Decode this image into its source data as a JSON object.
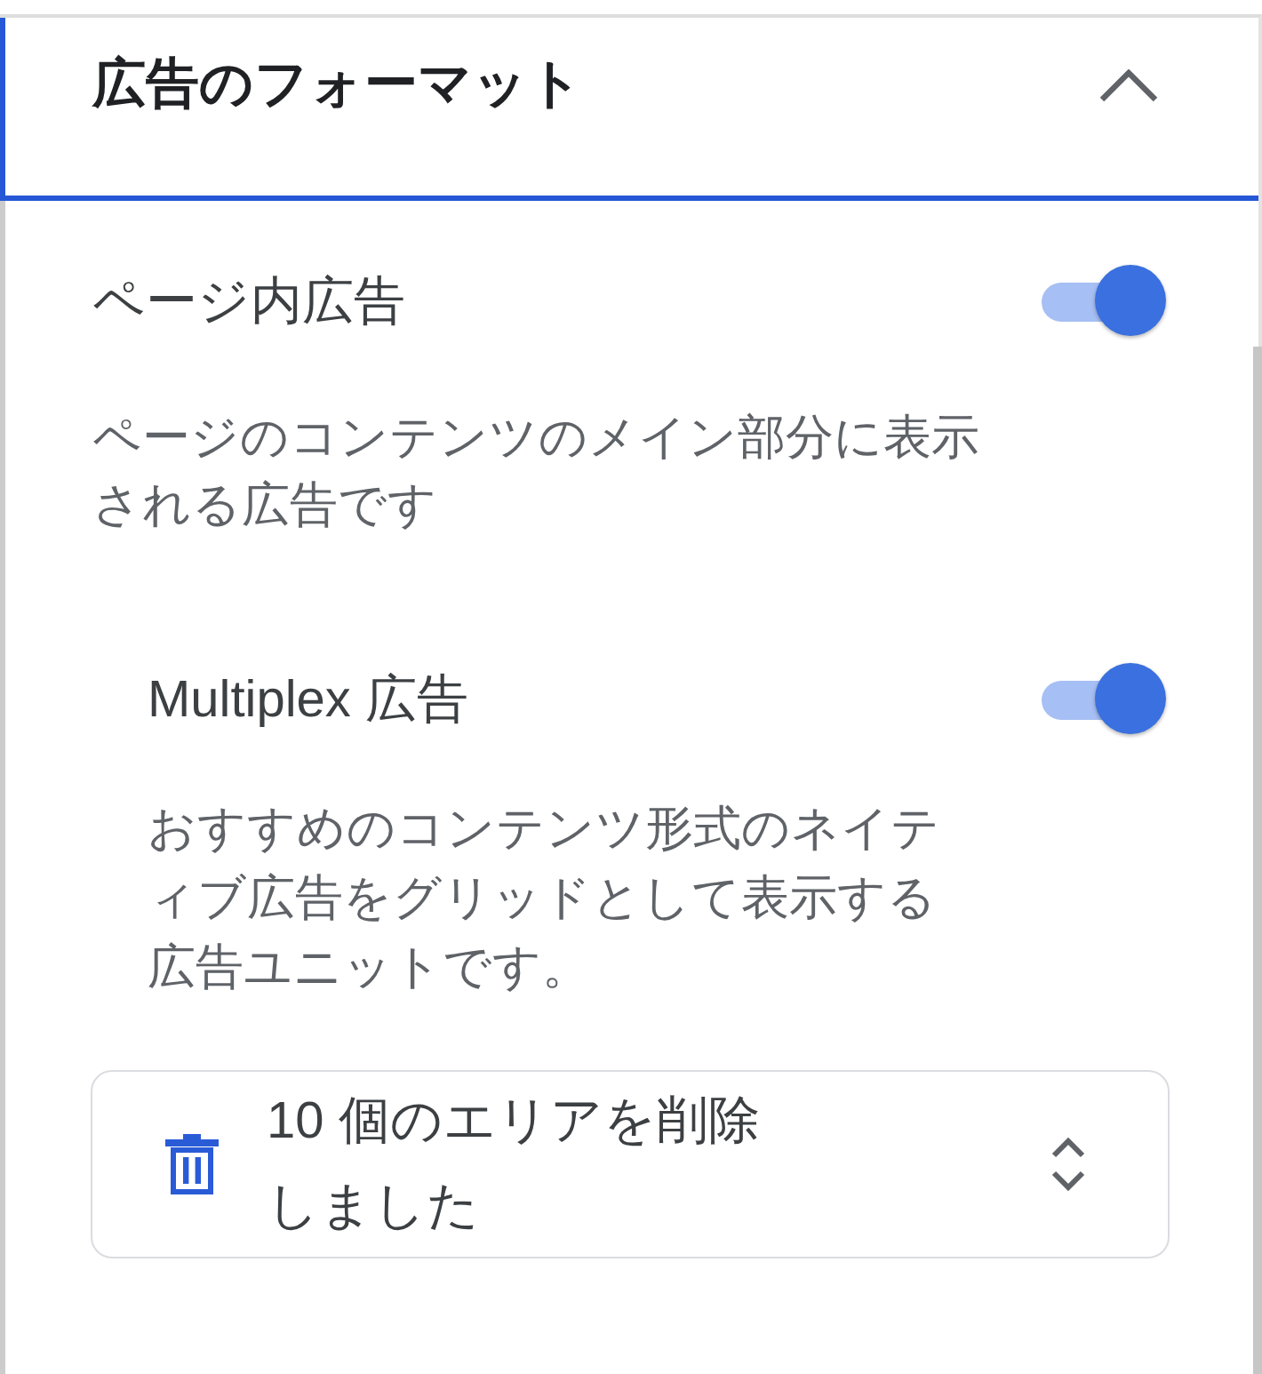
{
  "section": {
    "title": "広告のフォーマット",
    "expanded": true
  },
  "settings": [
    {
      "label": "ページ内広告",
      "on": true,
      "description": "ページのコンテンツのメイン部分に表示される広告です",
      "children": [
        {
          "label": "Multiplex 広告",
          "on": true,
          "description": "おすすめのコンテンツ形式のネイティブ広告をグリッドとして表示する広告ユニットです。"
        }
      ]
    }
  ],
  "area_select": {
    "value": "10 個のエリアを削除しました"
  }
}
